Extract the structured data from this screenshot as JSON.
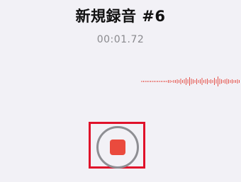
{
  "recording": {
    "title": "新規録音 #6",
    "elapsed": "00:01.72"
  },
  "controls": {
    "record_button_icon": "stop-icon",
    "record_button_state": "recording"
  },
  "colors": {
    "background": "#f2f1f6",
    "waveform": "#e5534b",
    "stop": "#ea4a3d",
    "ring": "#8e8e93",
    "highlight": "#e0112a"
  }
}
